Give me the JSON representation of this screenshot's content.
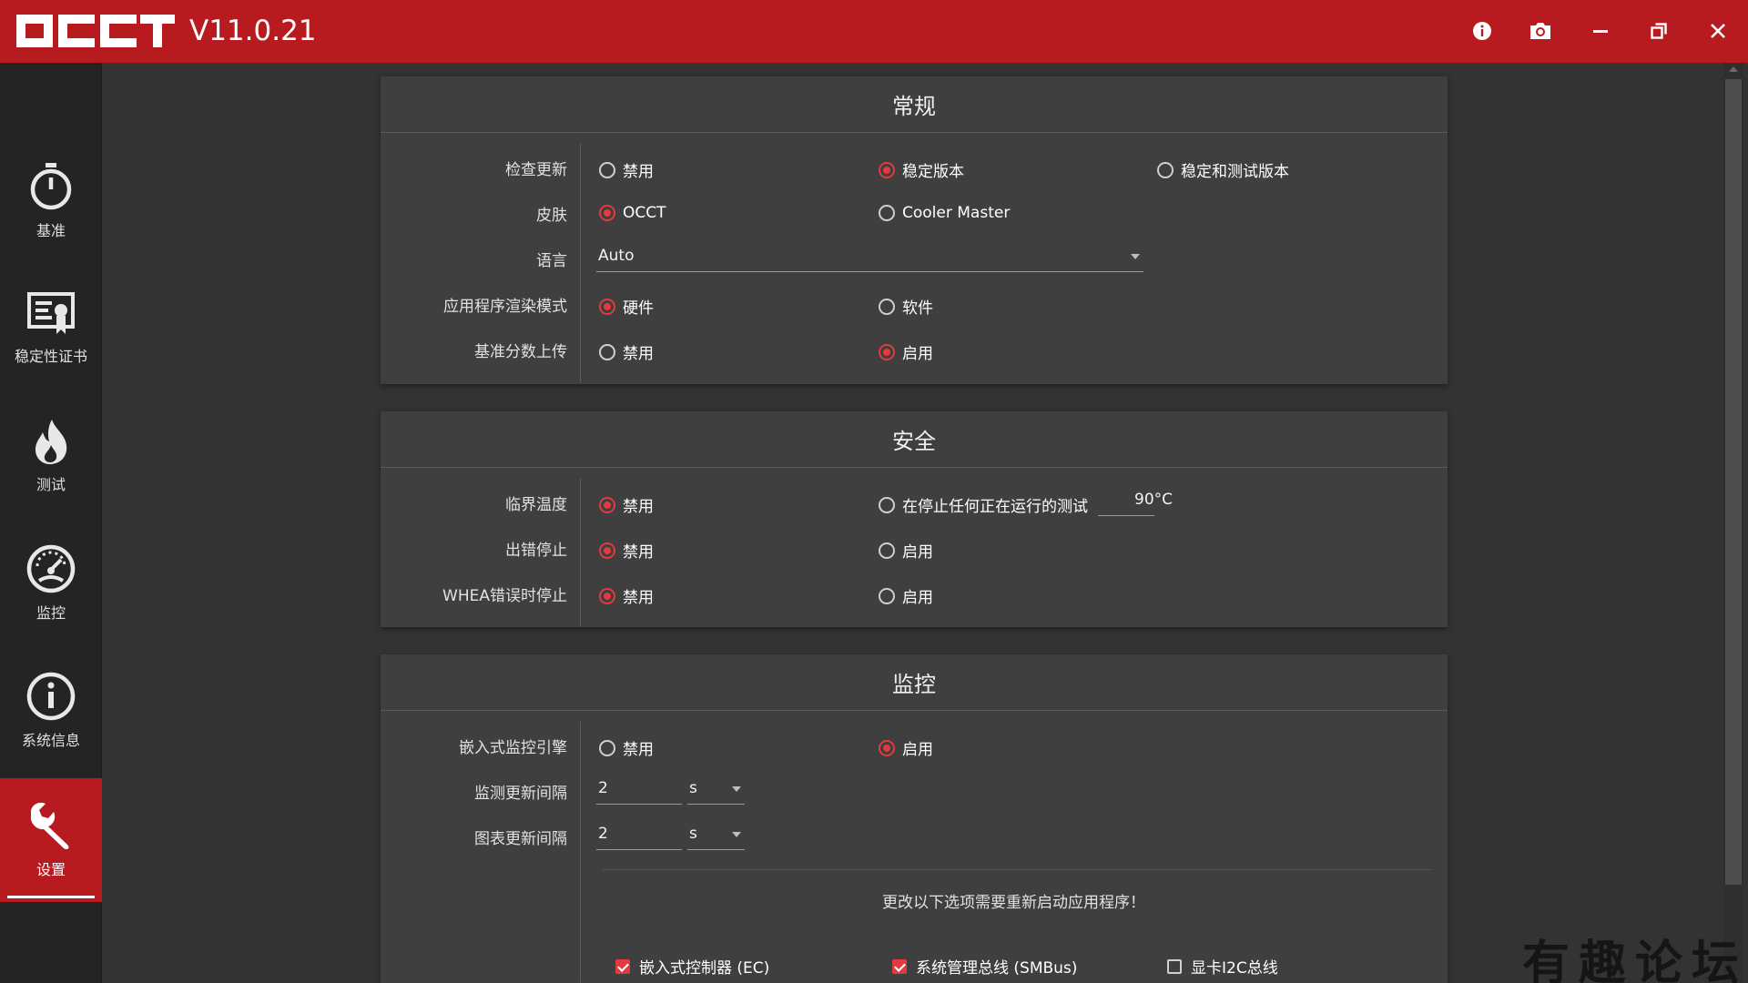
{
  "app": {
    "logo_text": "OCCT",
    "version": "V11.0.21"
  },
  "window_buttons": [
    "info-icon",
    "camera-icon",
    "minimize-icon",
    "restore-icon",
    "close-icon"
  ],
  "sidebar": {
    "items": [
      {
        "label": "基准",
        "icon": "stopwatch-icon"
      },
      {
        "label": "稳定性证书",
        "icon": "certificate-icon"
      },
      {
        "label": "测试",
        "icon": "flame-icon"
      },
      {
        "label": "监控",
        "icon": "gauge-icon"
      },
      {
        "label": "系统信息",
        "icon": "info-circle-icon"
      },
      {
        "label": "设置",
        "icon": "wrench-icon",
        "active": true
      }
    ]
  },
  "general": {
    "title": "常规",
    "check_update": {
      "label": "检查更新",
      "options": [
        "禁用",
        "稳定版本",
        "稳定和测试版本"
      ],
      "selected": "稳定版本"
    },
    "skin": {
      "label": "皮肤",
      "options": [
        "OCCT",
        "Cooler Master"
      ],
      "selected": "OCCT"
    },
    "language": {
      "label": "语言",
      "value": "Auto"
    },
    "render_mode": {
      "label": "应用程序渲染模式",
      "options": [
        "硬件",
        "软件"
      ],
      "selected": "硬件"
    },
    "score_upload": {
      "label": "基准分数上传",
      "options": [
        "禁用",
        "启用"
      ],
      "selected": "启用"
    }
  },
  "safety": {
    "title": "安全",
    "critical_temp": {
      "label": "临界温度",
      "options": [
        "禁用",
        "在停止任何正在运行的测试"
      ],
      "selected": "禁用",
      "temp_value": "90°C"
    },
    "stop_on_error": {
      "label": "出错停止",
      "options": [
        "禁用",
        "启用"
      ],
      "selected": "禁用"
    },
    "whea_stop": {
      "label": "WHEA错误时停止",
      "options": [
        "禁用",
        "启用"
      ],
      "selected": "禁用"
    }
  },
  "monitoring": {
    "title": "监控",
    "embedded_engine": {
      "label": "嵌入式监控引擎",
      "options": [
        "禁用",
        "启用"
      ],
      "selected": "启用"
    },
    "monitor_interval": {
      "label": "监测更新间隔",
      "value": "2",
      "unit": "s"
    },
    "chart_interval": {
      "label": "图表更新间隔",
      "value": "2",
      "unit": "s"
    },
    "restart_note": "更改以下选项需要重新启动应用程序！",
    "checkboxes": [
      {
        "label": "嵌入式控制器 (EC)",
        "checked": true
      },
      {
        "label": "系统管理总线 (SMBus)",
        "checked": true
      },
      {
        "label": "显卡I2C总线",
        "checked": false
      }
    ]
  },
  "watermark": "有趣论坛",
  "colors": {
    "accent": "#b71b1f",
    "radio_checked": "#e23a3f",
    "background": "#333333",
    "panel": "#3f3f3f",
    "sidebar": "#242424"
  }
}
